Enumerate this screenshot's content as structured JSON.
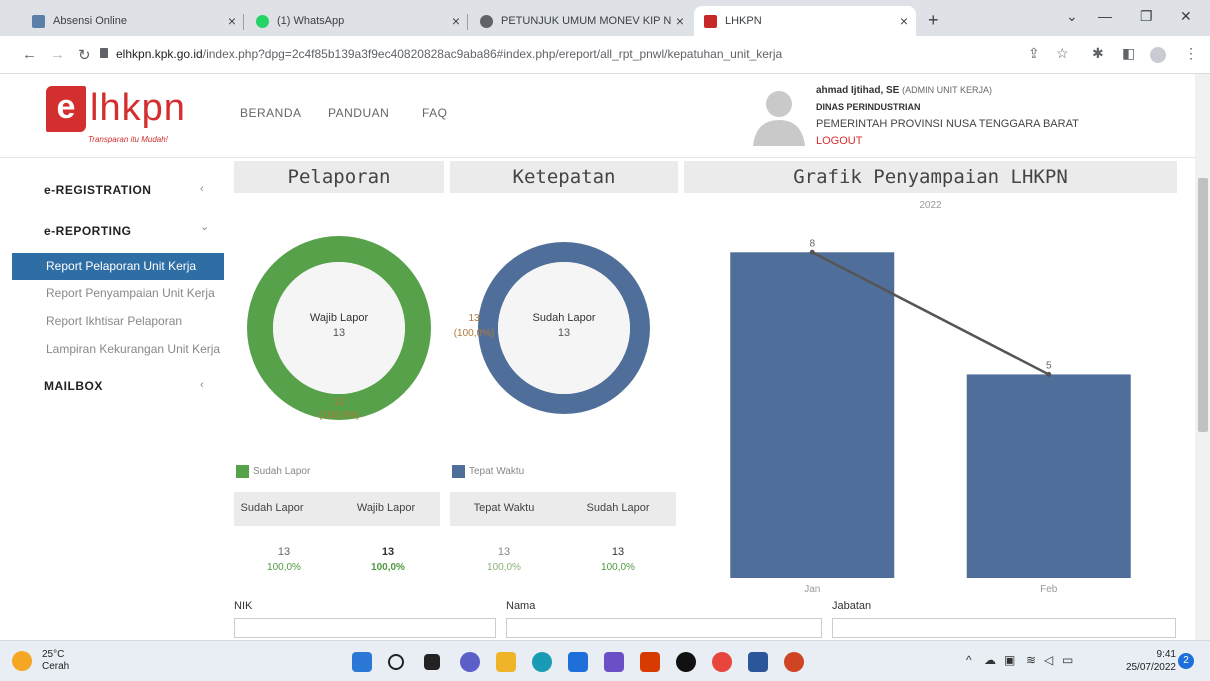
{
  "browser": {
    "tabs": [
      {
        "title": "Absensi Online",
        "color": "#5b7fa8"
      },
      {
        "title": "(1) WhatsApp",
        "color": "#25d366"
      },
      {
        "title": "PETUNJUK UMUM MONEV KIP N",
        "color": "#5f6368"
      },
      {
        "title": "LHKPN",
        "color": "#c62828"
      }
    ],
    "new_tab": "+",
    "url_host": "elhkpn.kpk.go.id",
    "url_path": "/index.php?dpg=2c4f85b139a3f9ec40820828ac9aba86#index.php/ereport/all_rpt_pnwl/kepatuhan_unit_kerja"
  },
  "header": {
    "logo_letter": "e",
    "logo_word": "lhkpn",
    "tagline": "Transparan itu Mudah!",
    "nav": [
      "BERANDA",
      "PANDUAN",
      "FAQ"
    ],
    "user_name": "ahmad Ijtihad, SE",
    "user_role": "(ADMIN UNIT KERJA)",
    "dinas": "DINAS PERINDUSTRIAN",
    "pemerintah": "PEMERINTAH PROVINSI NUSA TENGGARA BARAT",
    "logout": "LOGOUT"
  },
  "sidebar": {
    "sections": [
      {
        "label": "e-REGISTRATION",
        "caret": "‹"
      },
      {
        "label": "e-REPORTING",
        "caret": "⌄"
      },
      {
        "label": "MAILBOX",
        "caret": "‹"
      }
    ],
    "items": [
      "Report Pelaporan Unit Kerja",
      "Report Penyampaian Unit Kerja",
      "Report Ikhtisar Pelaporan",
      "Lampiran Kekurangan Unit Kerja"
    ]
  },
  "pelaporan": {
    "title": "Pelaporan",
    "center_label": "Wajib Lapor",
    "center_value": "13",
    "slice_value": "13",
    "slice_pct": "(100,0%)",
    "color": "#57a14b",
    "legend": "Sudah Lapor",
    "col1": "Sudah Lapor",
    "col2": "Wajib Lapor",
    "v1": "13",
    "p1": "100,0%",
    "v2": "13",
    "p2": "100,0%"
  },
  "ketepatan": {
    "title": "Ketepatan",
    "center_label": "Sudah Lapor",
    "center_value": "13",
    "slice_value": "13",
    "slice_pct": "(100,0%)",
    "color": "#4f6f9a",
    "legend": "Tepat Waktu",
    "col1": "Tepat Waktu",
    "col2": "Sudah Lapor",
    "v1": "13",
    "p1": "100,0%",
    "v2": "13",
    "p2": "100,0%"
  },
  "grafik": {
    "title": "Grafik Penyampaian LHKPN",
    "year": "2022"
  },
  "chart_data": {
    "type": "bar",
    "title": "Grafik Penyampaian LHKPN",
    "subtitle": "2022",
    "categories": [
      "Jan",
      "Feb"
    ],
    "values": [
      8,
      5
    ],
    "line_values": [
      8,
      5
    ],
    "ylim": [
      0,
      8.4
    ],
    "bar_color": "#4f6f9a",
    "line_color": "#555555",
    "grid": false,
    "legend": "none"
  },
  "filters": {
    "nik": "NIK",
    "nama": "Nama",
    "jabatan": "Jabatan"
  },
  "taskbar": {
    "temp": "25°C",
    "weather": "Cerah",
    "time": "9:41",
    "date": "25/07/2022",
    "notif": "2"
  }
}
